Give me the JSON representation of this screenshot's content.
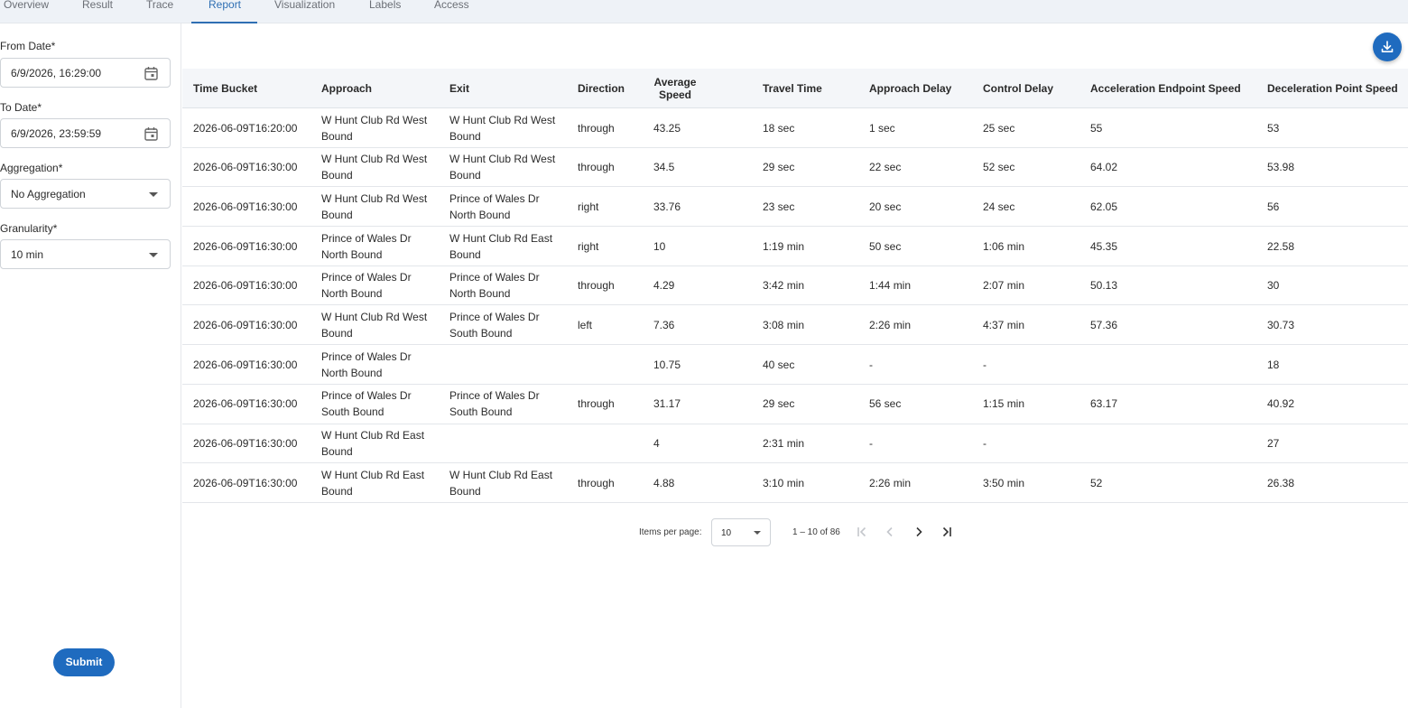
{
  "tabs": [
    {
      "label": "Overview"
    },
    {
      "label": "Result"
    },
    {
      "label": "Trace"
    },
    {
      "label": "Report"
    },
    {
      "label": "Visualization"
    },
    {
      "label": "Labels"
    },
    {
      "label": "Access"
    }
  ],
  "active_tab": "Report",
  "sidebar": {
    "from_date": {
      "label": "From Date*",
      "value": "6/9/2026, 16:29:00",
      "icon": "calendar-icon"
    },
    "to_date": {
      "label": "To Date*",
      "value": "6/9/2026, 23:59:59",
      "icon": "calendar-icon"
    },
    "aggregation": {
      "label": "Aggregation*",
      "value": "No Aggregation"
    },
    "granularity": {
      "label": "Granularity*",
      "value": "10 min"
    },
    "submit_label": "Submit"
  },
  "download_icon": "download-icon",
  "accent_color": "#1f6bbf",
  "table": {
    "headers": [
      "Time Bucket",
      "Approach",
      "Exit",
      "Direction",
      "Average Speed",
      "Travel Time",
      "Approach Delay",
      "Control Delay",
      "Acceleration Endpoint Speed",
      "Deceleration Point Speed"
    ],
    "rows": [
      [
        "2026-06-09T16:20:00",
        "W Hunt Club Rd West Bound",
        "W Hunt Club Rd West Bound",
        "through",
        "43.25",
        "18 sec",
        "1 sec",
        "25 sec",
        "55",
        "53"
      ],
      [
        "2026-06-09T16:30:00",
        "W Hunt Club Rd West Bound",
        "W Hunt Club Rd West Bound",
        "through",
        "34.5",
        "29 sec",
        "22 sec",
        "52 sec",
        "64.02",
        "53.98"
      ],
      [
        "2026-06-09T16:30:00",
        "W Hunt Club Rd West Bound",
        "Prince of Wales Dr North Bound",
        "right",
        "33.76",
        "23 sec",
        "20 sec",
        "24 sec",
        "62.05",
        "56"
      ],
      [
        "2026-06-09T16:30:00",
        "Prince of Wales Dr North Bound",
        "W Hunt Club Rd East Bound",
        "right",
        "10",
        "1:19 min",
        "50 sec",
        "1:06 min",
        "45.35",
        "22.58"
      ],
      [
        "2026-06-09T16:30:00",
        "Prince of Wales Dr North Bound",
        "Prince of Wales Dr North Bound",
        "through",
        "4.29",
        "3:42 min",
        "1:44 min",
        "2:07 min",
        "50.13",
        "30"
      ],
      [
        "2026-06-09T16:30:00",
        "W Hunt Club Rd West Bound",
        "Prince of Wales Dr South Bound",
        "left",
        "7.36",
        "3:08 min",
        "2:26 min",
        "4:37 min",
        "57.36",
        "30.73"
      ],
      [
        "2026-06-09T16:30:00",
        "Prince of Wales Dr North Bound",
        "",
        "",
        "10.75",
        "40 sec",
        "-",
        "-",
        "",
        "18"
      ],
      [
        "2026-06-09T16:30:00",
        "Prince of Wales Dr South Bound",
        "Prince of Wales Dr South Bound",
        "through",
        "31.17",
        "29 sec",
        "56 sec",
        "1:15 min",
        "63.17",
        "40.92"
      ],
      [
        "2026-06-09T16:30:00",
        "W Hunt Club Rd East Bound",
        "",
        "",
        "4",
        "2:31 min",
        "-",
        "-",
        "",
        "27"
      ],
      [
        "2026-06-09T16:30:00",
        "W Hunt Club Rd East Bound",
        "W Hunt Club Rd East Bound",
        "through",
        "4.88",
        "3:10 min",
        "2:26 min",
        "3:50 min",
        "52",
        "26.38"
      ]
    ]
  },
  "pagination": {
    "items_per_page_label": "Items per page:",
    "items_per_page": "10",
    "range": "1 – 10 of 86",
    "icons": [
      "first-page-icon",
      "previous-page-icon",
      "next-page-icon",
      "last-page-icon"
    ]
  }
}
